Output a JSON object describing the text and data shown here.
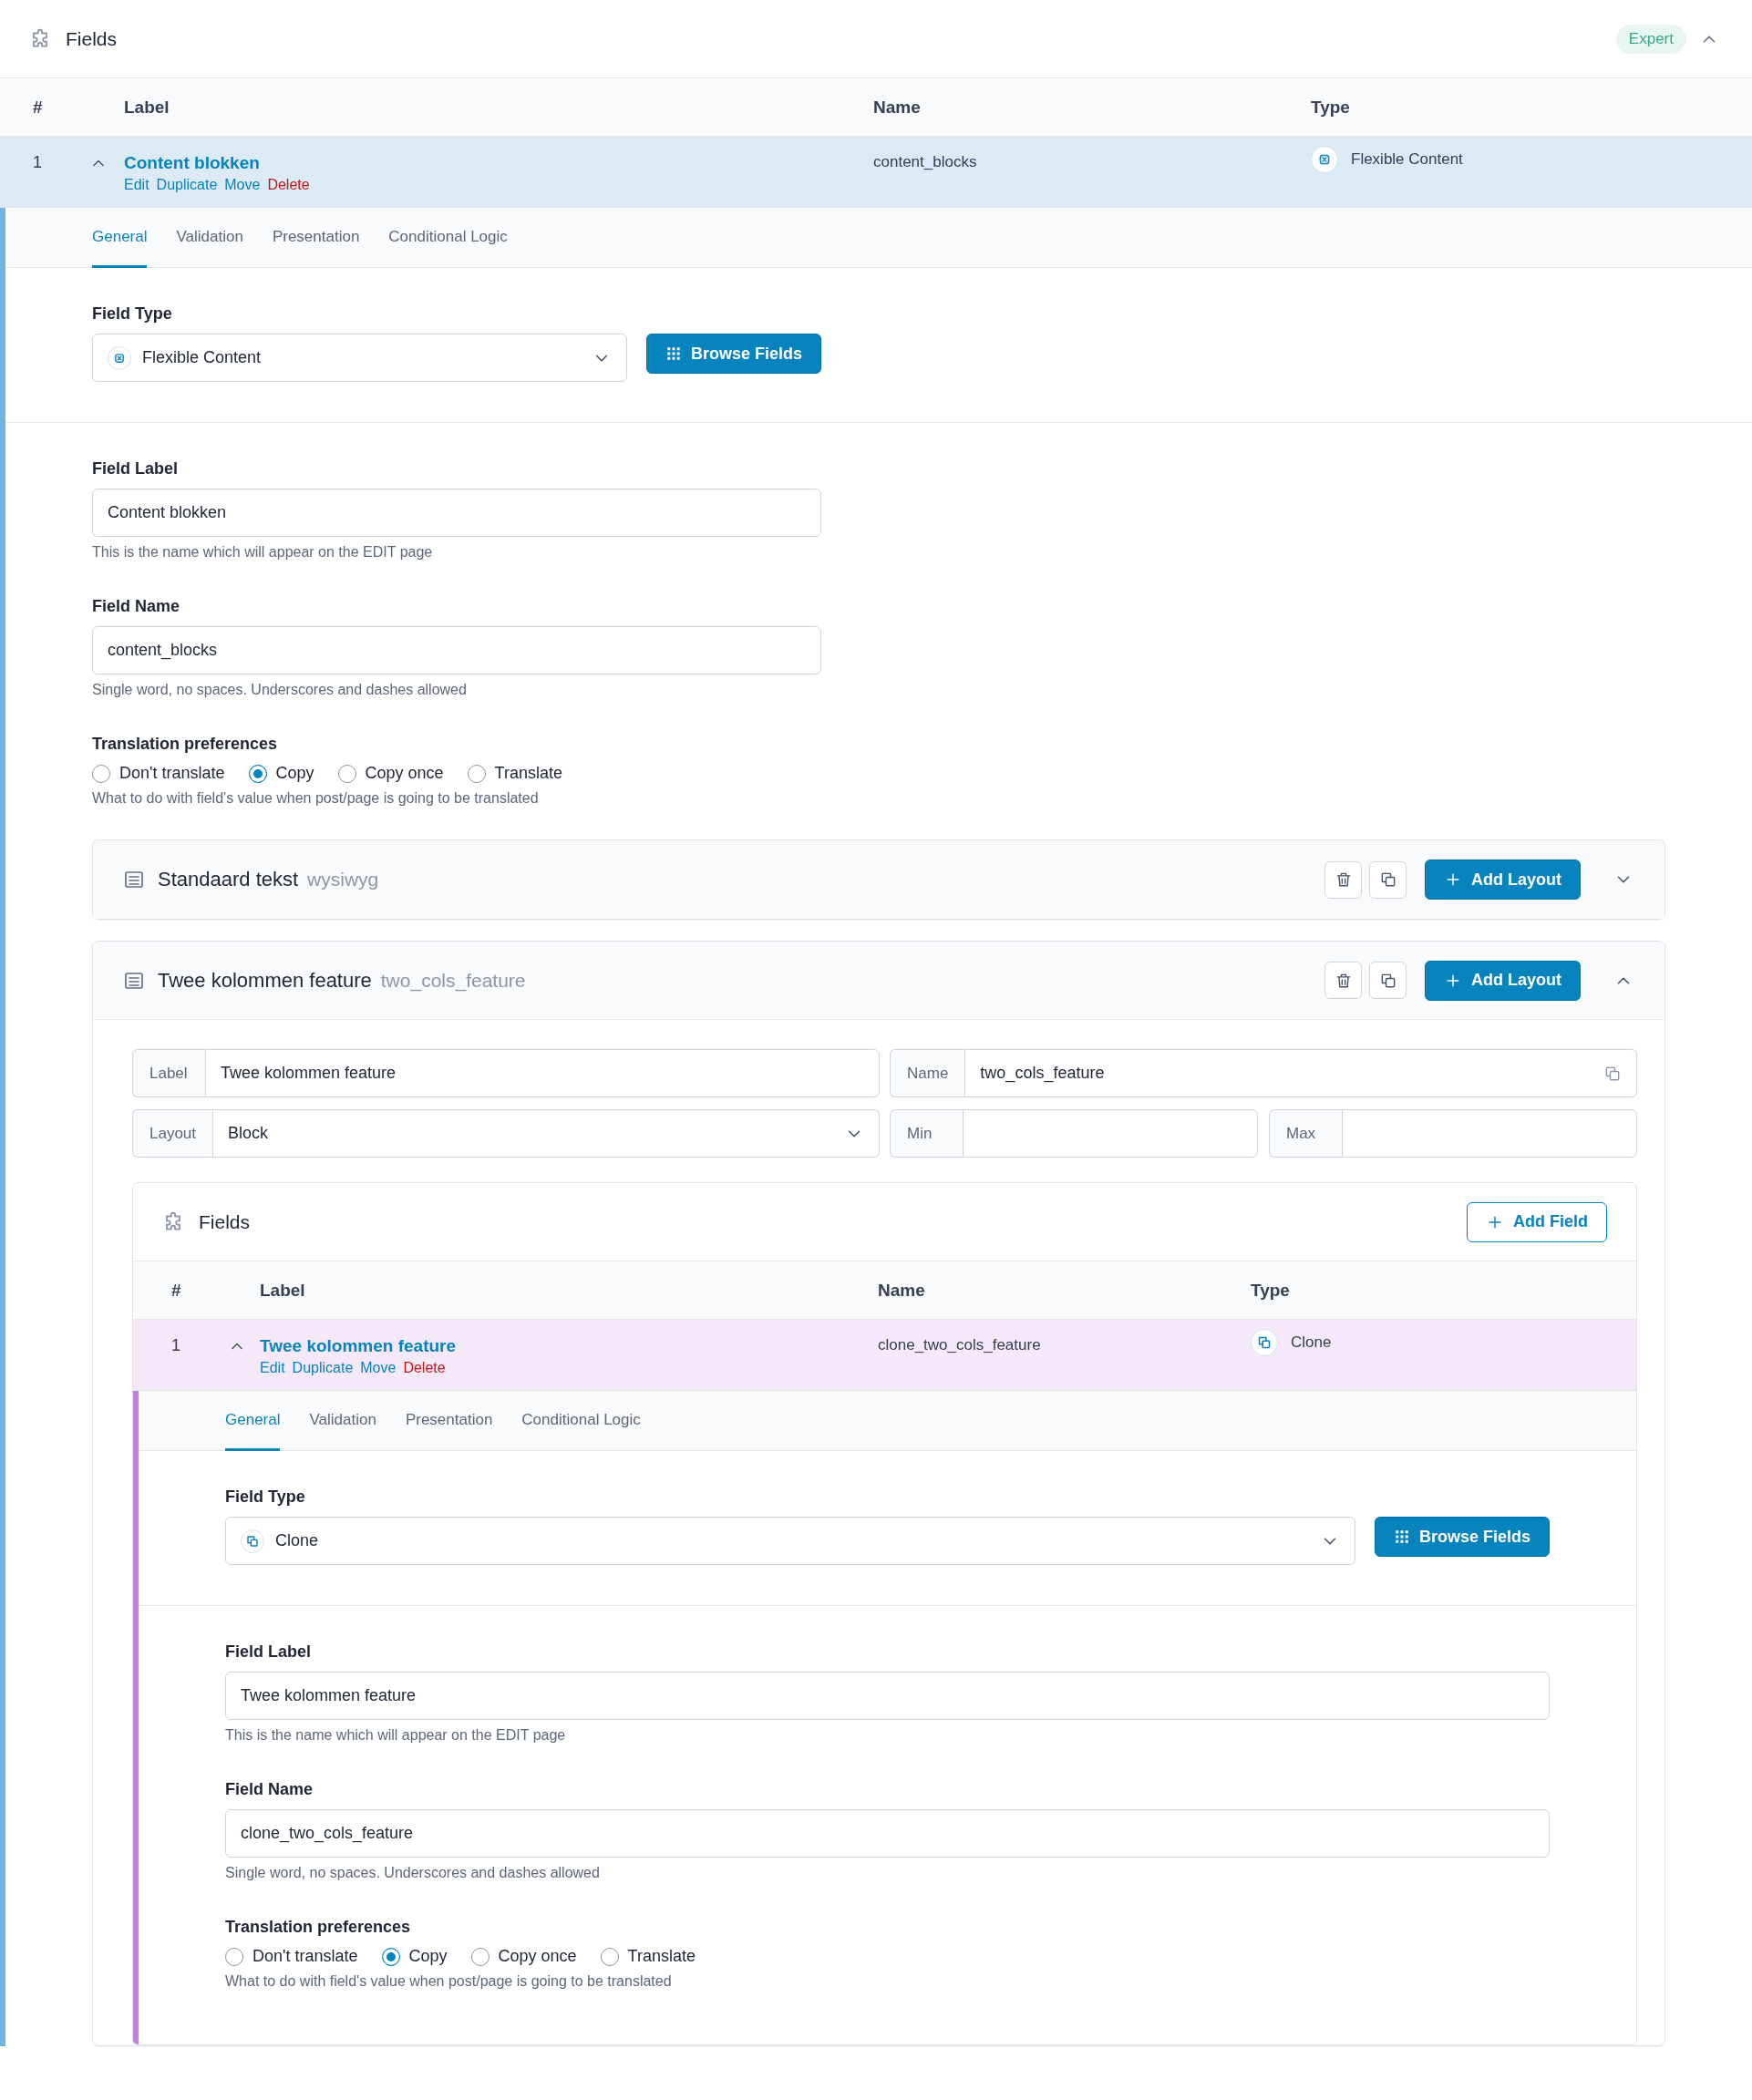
{
  "fields_panel": {
    "title": "Fields",
    "badge": "Expert",
    "expanded": true,
    "columns": [
      "#",
      "Label",
      "Name",
      "Type"
    ],
    "field": {
      "number": "1",
      "label": "Content blokken",
      "expanded": true,
      "kind": "flexible_content",
      "name": "content_blocks",
      "type": "Flexible Content",
      "actions": [
        {
          "label": "Edit",
          "kind": "link"
        },
        {
          "label": "Duplicate",
          "kind": "link"
        },
        {
          "label": "Move",
          "kind": "link"
        },
        {
          "label": "Delete",
          "kind": "danger"
        }
      ],
      "tabs": [
        {
          "label": "General",
          "selected": true
        },
        {
          "label": "Validation",
          "selected": false
        },
        {
          "label": "Presentation",
          "selected": false
        },
        {
          "label": "Conditional Logic",
          "selected": false
        }
      ],
      "settings": {
        "field_type": {
          "label": "Field Type",
          "value": "Flexible Content"
        },
        "browse_button": "Browse Fields",
        "field_label": {
          "label": "Field Label",
          "value": "Content blokken",
          "help": "This is the name which will appear on the EDIT page"
        },
        "field_name": {
          "label": "Field Name",
          "value": "content_blocks",
          "help": "Single word, no spaces. Underscores and dashes allowed"
        },
        "translation": {
          "label": "Translation preferences",
          "options": [
            {
              "label": "Don't translate",
              "selected": false
            },
            {
              "label": "Copy",
              "selected": true
            },
            {
              "label": "Copy once",
              "selected": false
            },
            {
              "label": "Translate",
              "selected": false
            }
          ],
          "help": "What to do with field's value when post/page is going to be translated"
        }
      },
      "layouts": [
        {
          "title": "Standaard tekst",
          "slug": "wysiwyg",
          "expanded": false,
          "add_button": "Add Layout"
        },
        {
          "title": "Twee kolommen feature",
          "slug": "two_cols_feature",
          "expanded": true,
          "add_button": "Add Layout",
          "label_field": {
            "label": "Label",
            "value": "Twee kolommen feature"
          },
          "name_field": {
            "label": "Name",
            "value": "two_cols_feature"
          },
          "layout_field": {
            "label": "Layout",
            "value": "Block"
          },
          "min_field": {
            "label": "Min"
          },
          "max_field": {
            "label": "Max"
          },
          "sub_fields": {
            "title": "Fields",
            "add_button": "Add Field",
            "columns": [
              "#",
              "Label",
              "Name",
              "Type"
            ],
            "field": {
              "number": "1",
              "label": "Twee kolommen feature",
              "expanded": true,
              "kind": "clone",
              "name": "clone_two_cols_feature",
              "type": "Clone",
              "actions": [
                {
                  "label": "Edit",
                  "kind": "link"
                },
                {
                  "label": "Duplicate",
                  "kind": "link"
                },
                {
                  "label": "Move",
                  "kind": "link"
                },
                {
                  "label": "Delete",
                  "kind": "danger"
                }
              ],
              "tabs": [
                {
                  "label": "General",
                  "selected": true
                },
                {
                  "label": "Validation",
                  "selected": false
                },
                {
                  "label": "Presentation",
                  "selected": false
                },
                {
                  "label": "Conditional Logic",
                  "selected": false
                }
              ],
              "settings": {
                "field_type": {
                  "label": "Field Type",
                  "value": "Clone"
                },
                "browse_button": "Browse Fields",
                "field_label": {
                  "label": "Field Label",
                  "value": "Twee kolommen feature",
                  "help": "This is the name which will appear on the EDIT page"
                },
                "field_name": {
                  "label": "Field Name",
                  "value": "clone_two_cols_feature",
                  "help": "Single word, no spaces. Underscores and dashes allowed"
                },
                "translation": {
                  "label": "Translation preferences",
                  "options": [
                    {
                      "label": "Don't translate",
                      "selected": false
                    },
                    {
                      "label": "Copy",
                      "selected": true
                    },
                    {
                      "label": "Copy once",
                      "selected": false
                    },
                    {
                      "label": "Translate",
                      "selected": false
                    }
                  ],
                  "help": "What to do with field's value when post/page is going to be translated"
                }
              }
            }
          }
        }
      ]
    }
  }
}
